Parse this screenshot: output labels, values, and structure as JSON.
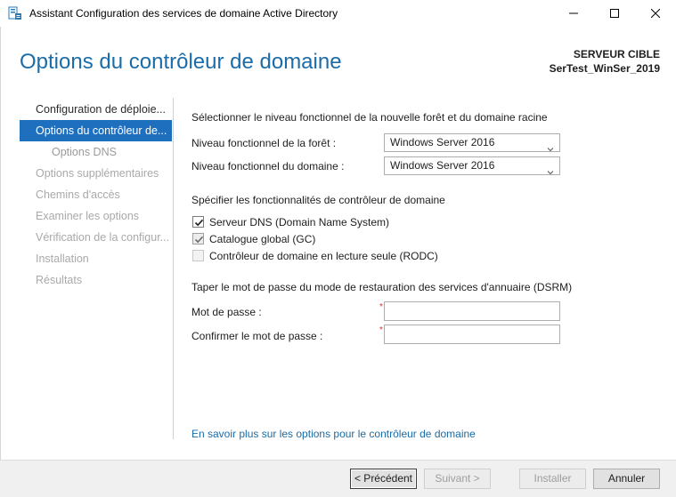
{
  "window": {
    "title": "Assistant Configuration des services de domaine Active Directory"
  },
  "header": {
    "page_title": "Options du contrôleur de domaine",
    "server_label": "SERVEUR CIBLE",
    "server_name": "SerTest_WinSer_2019"
  },
  "nav": {
    "items": [
      {
        "label": "Configuration de déploie...",
        "state": "normal"
      },
      {
        "label": "Options du contrôleur de...",
        "state": "active"
      },
      {
        "label": "Options DNS",
        "state": "sub"
      },
      {
        "label": "Options supplémentaires",
        "state": "disabled"
      },
      {
        "label": "Chemins d'accès",
        "state": "disabled"
      },
      {
        "label": "Examiner les options",
        "state": "disabled"
      },
      {
        "label": "Vérification de la configur...",
        "state": "disabled"
      },
      {
        "label": "Installation",
        "state": "disabled"
      },
      {
        "label": "Résultats",
        "state": "disabled"
      }
    ]
  },
  "main": {
    "functional_heading": "Sélectionner le niveau fonctionnel de la nouvelle forêt et du domaine racine",
    "forest_level_label": "Niveau fonctionnel de la forêt :",
    "forest_level_value": "Windows Server 2016",
    "domain_level_label": "Niveau fonctionnel du domaine :",
    "domain_level_value": "Windows Server 2016",
    "features_heading": "Spécifier les fonctionnalités de contrôleur de domaine",
    "features": [
      {
        "label": "Serveur DNS (Domain Name System)",
        "checked": true,
        "enabled": true
      },
      {
        "label": "Catalogue global (GC)",
        "checked": true,
        "enabled": false
      },
      {
        "label": "Contrôleur de domaine en lecture seule (RODC)",
        "checked": false,
        "enabled": false
      }
    ],
    "dsrm_heading": "Taper le mot de passe du mode de restauration des services d'annuaire (DSRM)",
    "password_label": "Mot de passe :",
    "confirm_label": "Confirmer le mot de passe :",
    "required_marker": "*",
    "password_value": "",
    "confirm_value": "",
    "help_link": "En savoir plus sur les options pour le contrôleur de domaine"
  },
  "footer": {
    "previous_label": "< Précédent",
    "next_label": "Suivant >",
    "install_label": "Installer",
    "cancel_label": "Annuler"
  },
  "colors": {
    "accent": "#1f6fbf",
    "title_blue": "#1b6ca8",
    "required_red": "#d23a2a"
  },
  "icons": {
    "app": "server-manager-icon",
    "minimize": "minimize-icon",
    "maximize": "maximize-icon",
    "close": "close-icon",
    "dropdown": "chevron-down-icon",
    "check": "checkmark-icon"
  }
}
